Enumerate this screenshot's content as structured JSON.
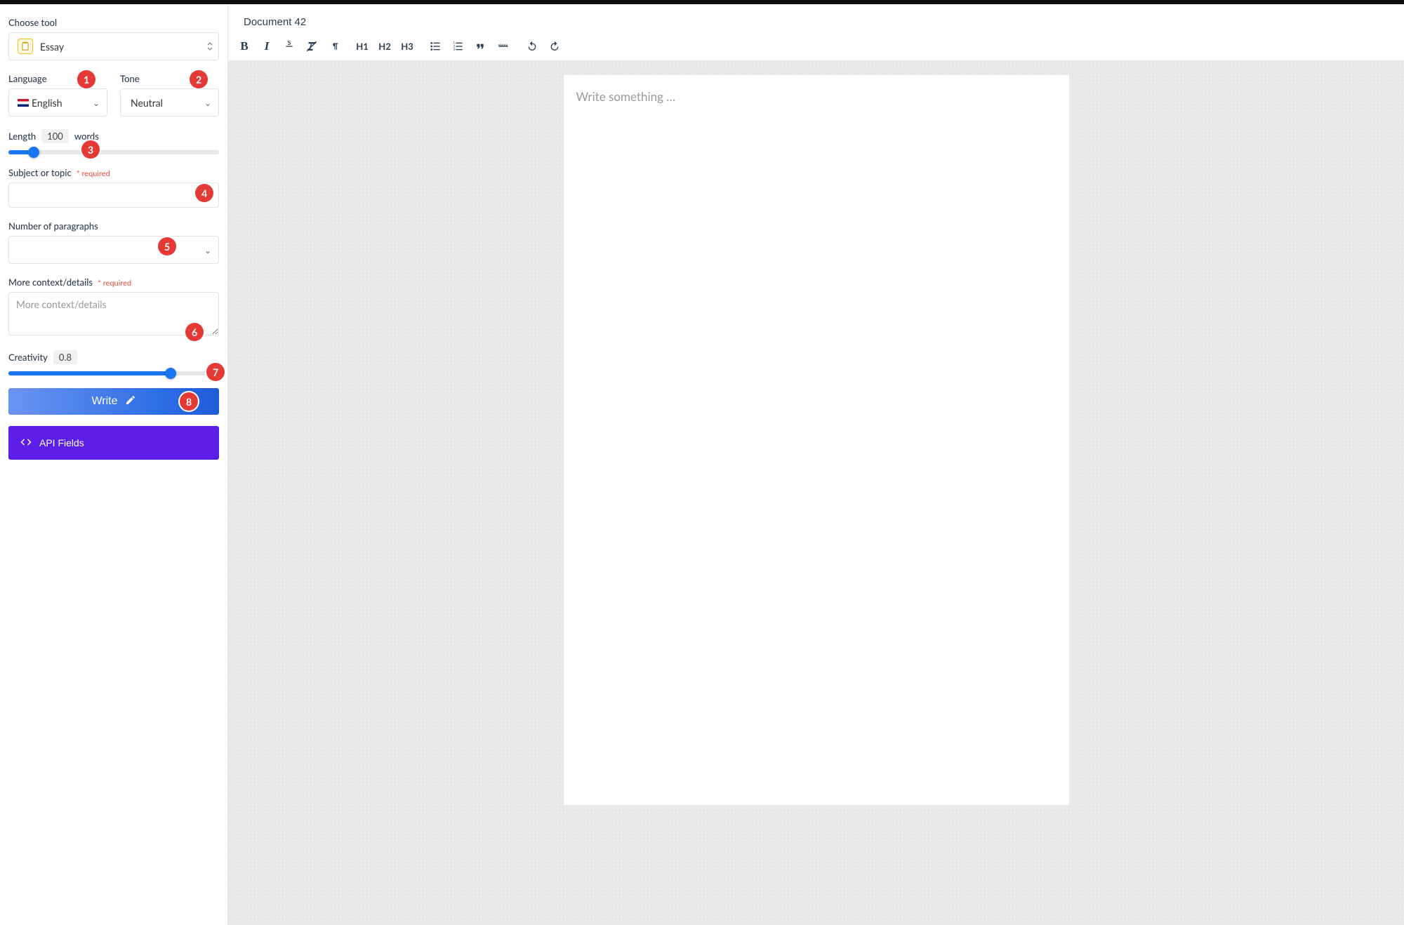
{
  "sidebar": {
    "choose_tool_label": "Choose tool",
    "tool_value": "Essay",
    "language_label": "Language",
    "language_value": "English",
    "tone_label": "Tone",
    "tone_value": "Neutral",
    "length_label": "Length",
    "length_value": "100",
    "length_unit": "words",
    "length_slider_percent": 12,
    "subject_label": "Subject or topic",
    "subject_required": "* required",
    "paragraphs_label": "Number of paragraphs",
    "context_label": "More context/details",
    "context_required": "* required",
    "context_placeholder": "More context/details",
    "creativity_label": "Creativity",
    "creativity_value": "0.8",
    "creativity_slider_percent": 77,
    "write_button": "Write",
    "api_button": "API Fields"
  },
  "doc": {
    "title": "Document 42",
    "placeholder": "Write something …"
  },
  "toolbar": {
    "bold": "B",
    "italic": "I",
    "strike": "S",
    "h1": "H1",
    "h2": "H2",
    "h3": "H3"
  },
  "badges": [
    "1",
    "2",
    "3",
    "4",
    "5",
    "6",
    "7",
    "8"
  ]
}
